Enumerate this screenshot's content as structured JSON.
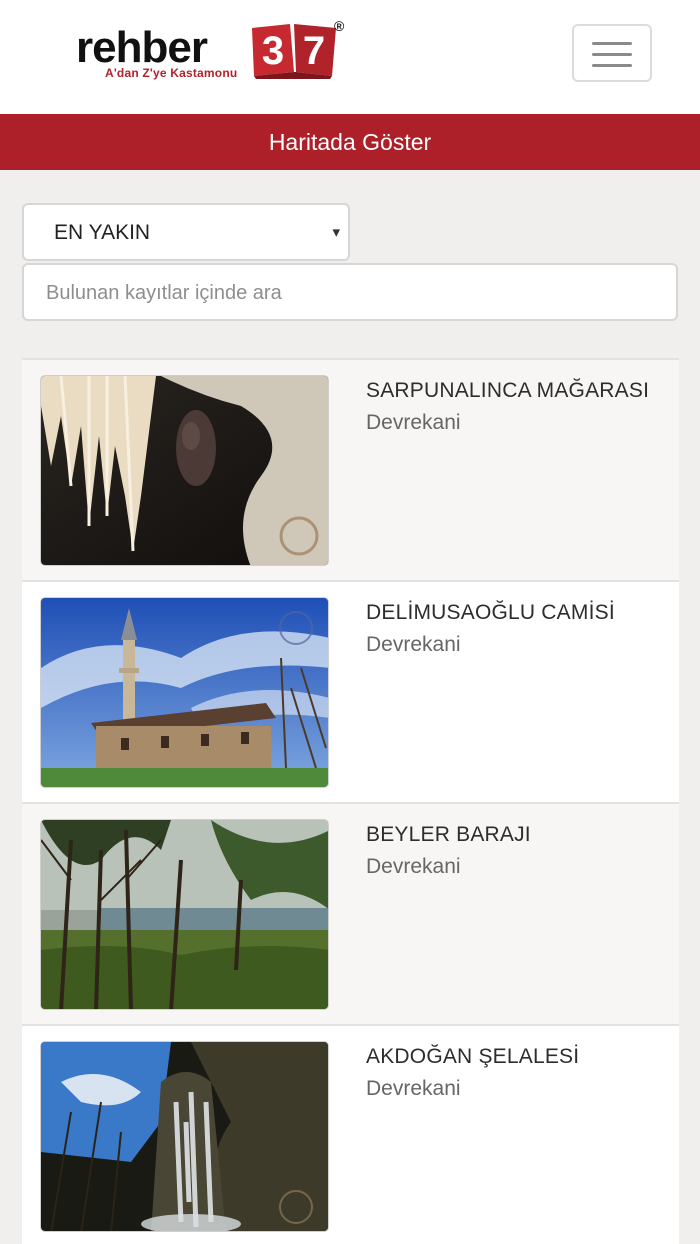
{
  "header": {
    "logo": {
      "wordmark": "rehber",
      "number": "37",
      "registered": "®",
      "tagline": "A'dan Z'ye Kastamonu"
    },
    "menu_icon": "hamburger-icon"
  },
  "map_bar": {
    "label": "Haritada Göster"
  },
  "sort": {
    "selected": "EN YAKIN",
    "caret": "▾"
  },
  "search": {
    "placeholder": "Bulunan kayıtlar içinde ara",
    "value": ""
  },
  "places": [
    {
      "title": "SARPUNALINCA MAĞARASI",
      "district": "Devrekani"
    },
    {
      "title": "DELİMUSAOĞLU CAMİSİ",
      "district": "Devrekani"
    },
    {
      "title": "BEYLER BARAJI",
      "district": "Devrekani"
    },
    {
      "title": "AKDOĞAN ŞELALESİ",
      "district": "Devrekani"
    }
  ],
  "colors": {
    "brand_red": "#ad1f29",
    "background": "#f0efee"
  }
}
